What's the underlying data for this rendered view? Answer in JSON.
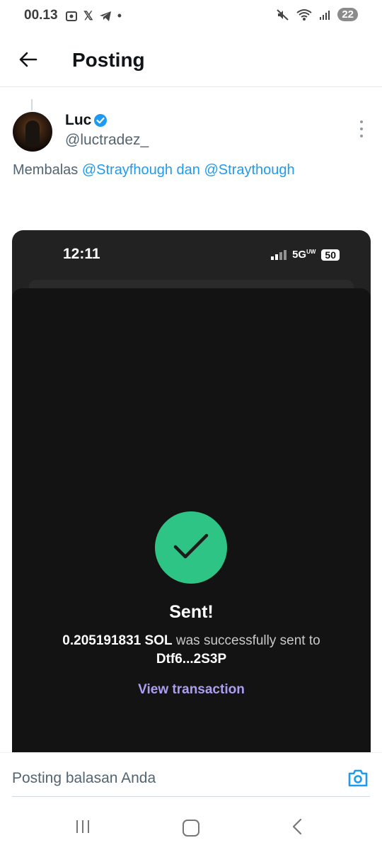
{
  "status_bar": {
    "time": "00.13",
    "notif_x": "𝕏",
    "notif_dot": "•",
    "battery": "22"
  },
  "header": {
    "title": "Posting"
  },
  "post": {
    "author_name": "Luc",
    "handle": "@luctradez_",
    "reply_prefix": "Membalas",
    "mention_1": "@Strayfhough",
    "reply_conjunction": "dan",
    "mention_2": "@Straythough"
  },
  "media": {
    "phone_time": "12:11",
    "network": "5G",
    "network_suffix": "UW",
    "phone_battery": "50",
    "title": "Sent!",
    "amount": "0.205191831 SOL",
    "message_mid": "was successfully sent to",
    "recipient": "Dtf6...2S3P",
    "link": "View transaction"
  },
  "reply": {
    "placeholder": "Posting balasan Anda"
  },
  "colors": {
    "link_blue": "#1d9bf0",
    "success_green": "#2ec486",
    "link_purple": "#ab9ff2"
  },
  "icons": [
    "back-arrow-icon",
    "verified-badge-icon",
    "more-vertical-icon",
    "checkmark-icon",
    "camera-icon",
    "nav-recents-icon",
    "nav-home-icon",
    "nav-back-icon",
    "mute-icon",
    "wifi-icon",
    "signal-icon",
    "x-icon",
    "telegram-icon",
    "screenshot-icon"
  ]
}
